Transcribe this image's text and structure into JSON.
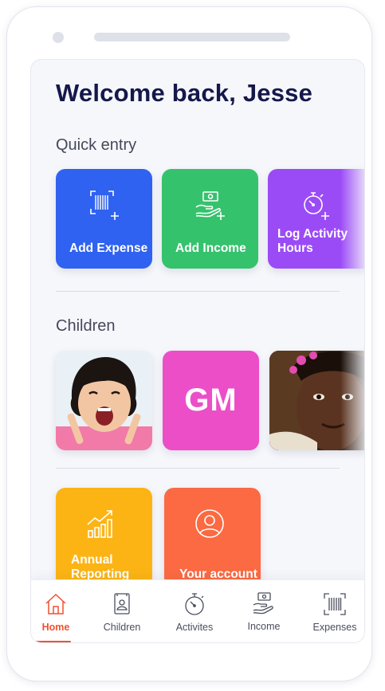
{
  "greeting": "Welcome back, Jesse",
  "quick_entry": {
    "title": "Quick entry",
    "tiles": [
      {
        "label": "Add Expense",
        "color": "#2f62f0",
        "icon": "barcode-add-icon"
      },
      {
        "label": "Add Income",
        "color": "#35c26d",
        "icon": "money-hand-add-icon"
      },
      {
        "label": "Log Activity Hours",
        "color": "#9b4bf6",
        "icon": "stopwatch-add-icon"
      }
    ]
  },
  "children": {
    "title": "Children",
    "items": [
      {
        "type": "photo",
        "description_icon": "child-photo"
      },
      {
        "type": "initials",
        "initials": "GM",
        "color": "#ec4ec8"
      },
      {
        "type": "photo",
        "description_icon": "child-photo"
      }
    ]
  },
  "more_tiles": [
    {
      "label": "Annual Reporting",
      "color": "#fcb415",
      "icon": "bar-chart-trend-icon"
    },
    {
      "label": "Your account",
      "color": "#fb6a42",
      "icon": "user-circle-icon"
    }
  ],
  "tabbar": {
    "active_color": "#f2512f",
    "tabs": [
      {
        "label": "Home",
        "icon": "home-icon",
        "active": true
      },
      {
        "label": "Children",
        "icon": "child-profile-icon",
        "active": false
      },
      {
        "label": "Activites",
        "icon": "stopwatch-icon",
        "active": false
      },
      {
        "label": "Income",
        "icon": "money-hand-icon",
        "active": false
      },
      {
        "label": "Expenses",
        "icon": "barcode-icon",
        "active": false
      }
    ]
  }
}
